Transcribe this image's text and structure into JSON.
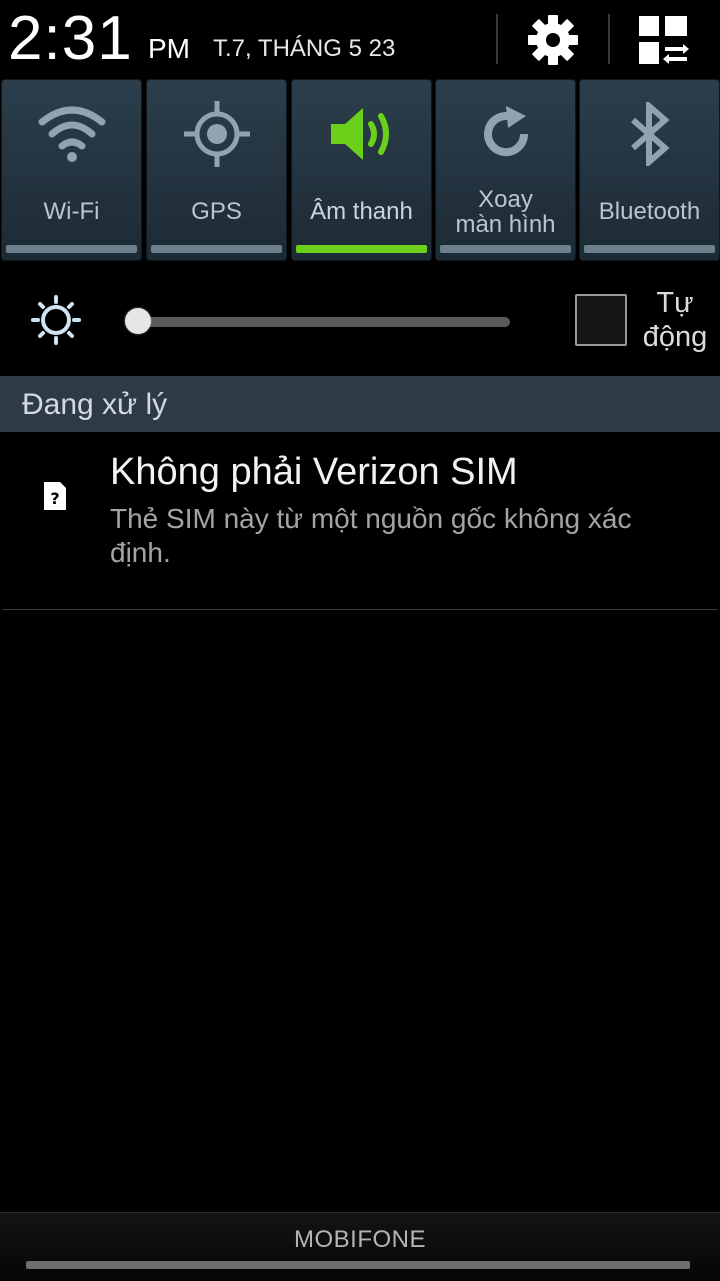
{
  "status": {
    "time": "2:31",
    "ampm": "PM",
    "date": "T.7, THÁNG 5 23"
  },
  "header_icons": [
    "gear-icon",
    "grid-edit-icon"
  ],
  "toggles": [
    {
      "label": "Wi-Fi",
      "icon": "wifi-icon",
      "on": false
    },
    {
      "label": "GPS",
      "icon": "gps-icon",
      "on": false
    },
    {
      "label": "Âm thanh",
      "icon": "sound-icon",
      "on": true
    },
    {
      "label_line1": "Xoay",
      "label_line2": "màn hình",
      "icon": "rotate-icon",
      "on": false
    },
    {
      "label": "Bluetooth",
      "icon": "bluetooth-icon",
      "on": false
    }
  ],
  "brightness": {
    "level": 0,
    "auto_label_line1": "Tự",
    "auto_label_line2": "động",
    "auto_checked": false
  },
  "section": {
    "title": "Đang xử lý"
  },
  "notification": {
    "icon": "sim-unknown-icon",
    "title": "Không phải Verizon SIM",
    "text": "Thẻ SIM này từ một nguồn gốc không xác định."
  },
  "footer": {
    "carrier": "MOBIFONE"
  },
  "colors": {
    "accent_on": "#6ad01a",
    "toggle_bg": "#2c3e4c",
    "icon_off": "#8fa3b1",
    "section_bg": "#2e3a45"
  }
}
